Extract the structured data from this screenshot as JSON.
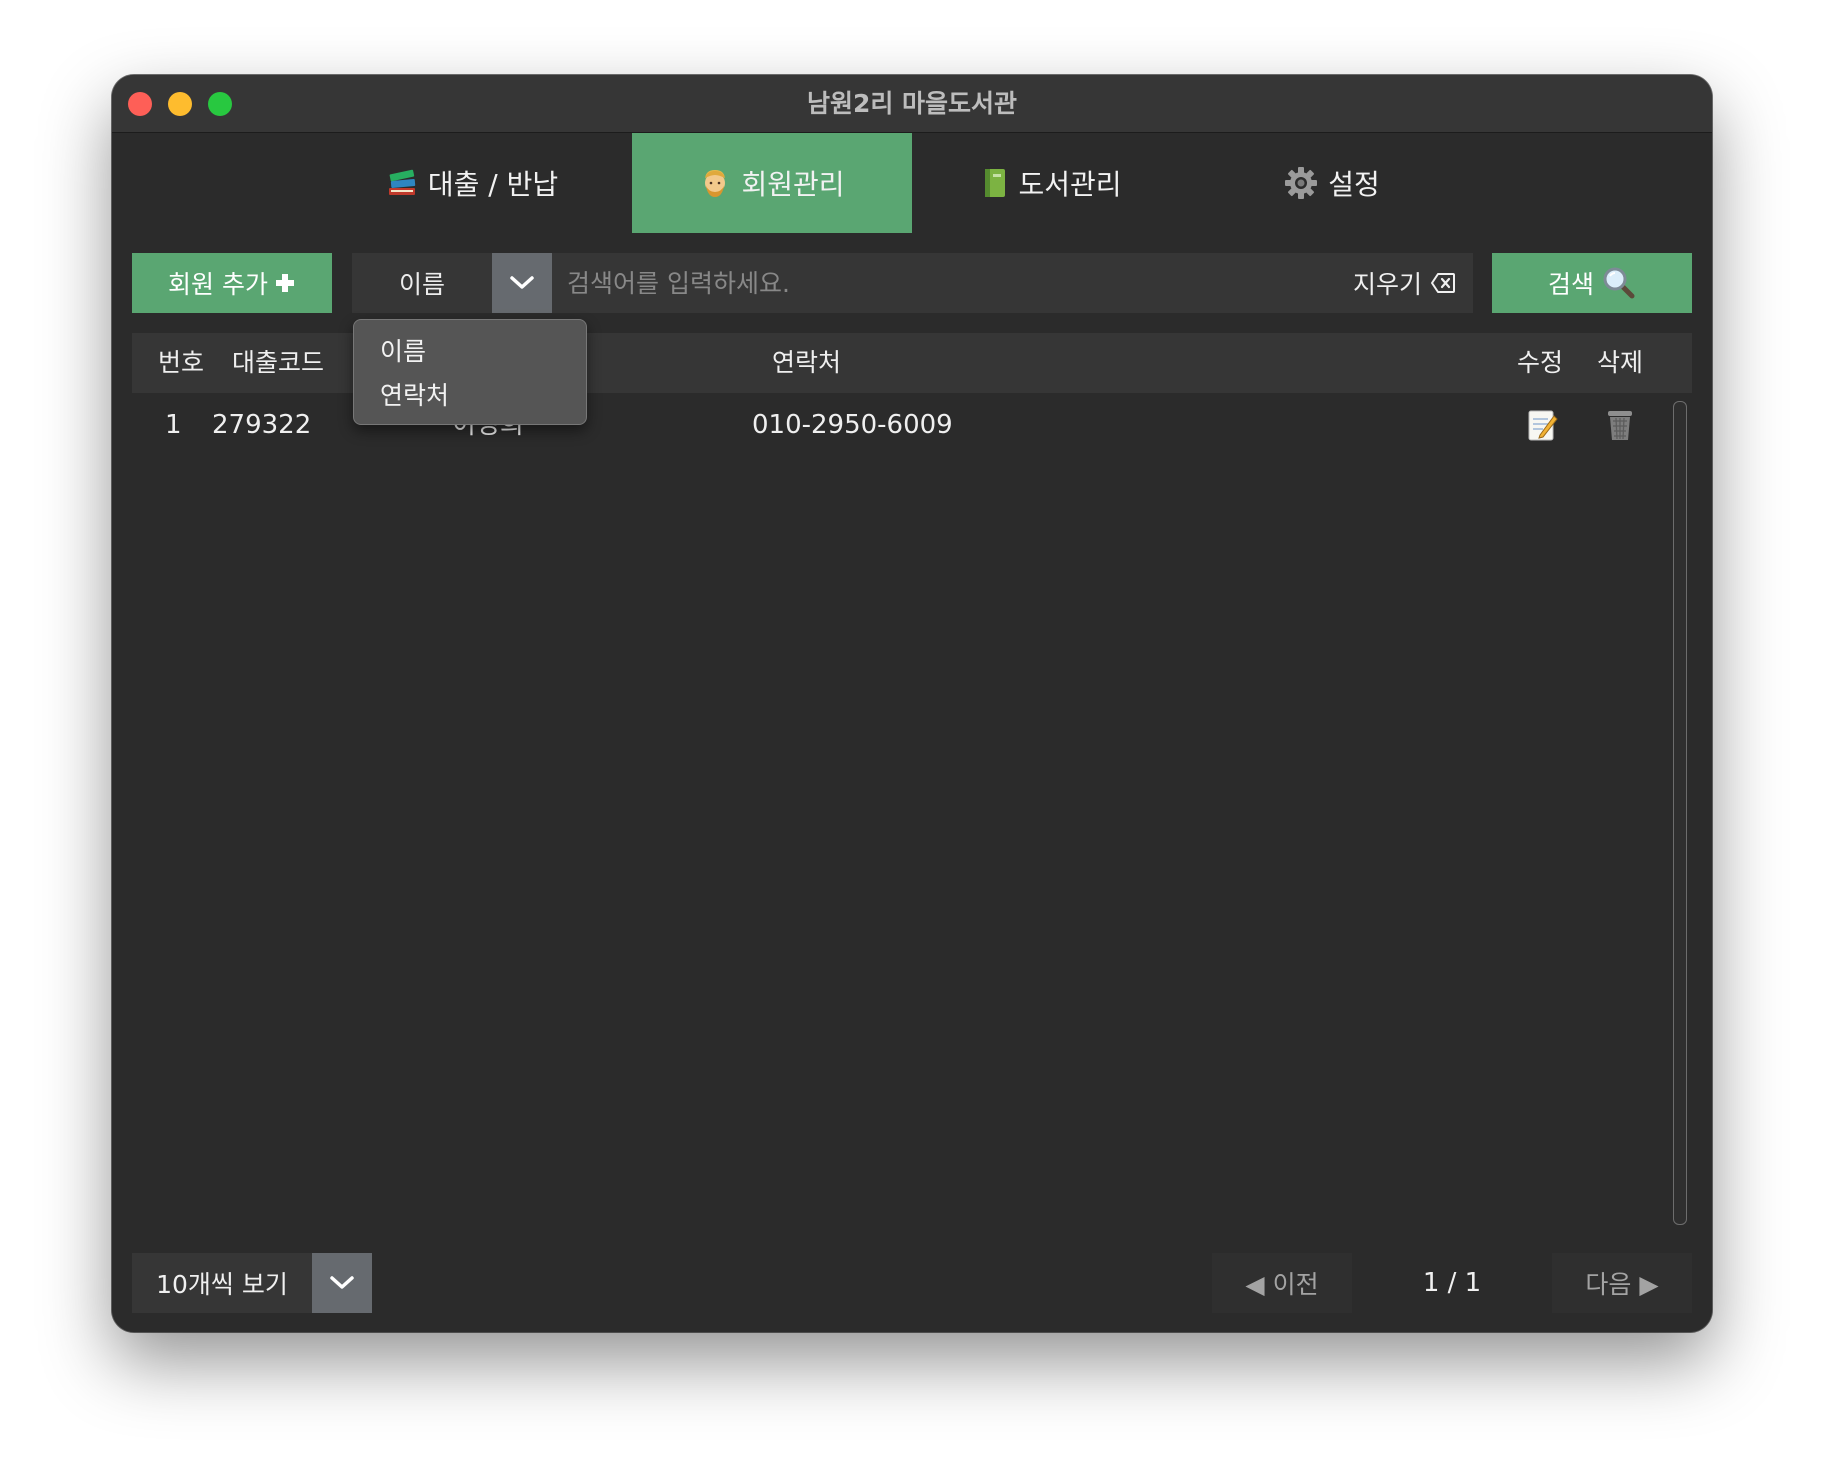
{
  "window": {
    "title": "남원2리 마을도서관"
  },
  "tabs": [
    {
      "label": "대출 / 반납",
      "icon": "books-icon",
      "active": false
    },
    {
      "label": "회원관리",
      "icon": "person-icon",
      "active": true
    },
    {
      "label": "도서관리",
      "icon": "green-book-icon",
      "active": false
    },
    {
      "label": "설정",
      "icon": "gear-icon",
      "active": false
    }
  ],
  "toolbar": {
    "add_member_label": "회원 추가",
    "search_field_selected": "이름",
    "search_placeholder": "검색어를 입력하세요.",
    "search_value": "",
    "clear_label": "지우기",
    "search_label": "검색"
  },
  "dropdown": {
    "options": [
      "이름",
      "연락처"
    ]
  },
  "table": {
    "headers": {
      "no": "번호",
      "code": "대출코드",
      "contact": "연락처",
      "edit": "수정",
      "delete": "삭제"
    },
    "rows": [
      {
        "no": "1",
        "code": "279322",
        "name": "이성희",
        "contact": "010-2950-6009"
      }
    ]
  },
  "footer": {
    "per_page_label": "10개씩 보기",
    "prev_label": "◀ 이전",
    "page_info": "1 / 1",
    "next_label": "다음 ▶"
  },
  "colors": {
    "accent": "#5aa672",
    "background": "#2b2b2b",
    "panel": "#363636",
    "arrow_button": "#666a6f"
  }
}
